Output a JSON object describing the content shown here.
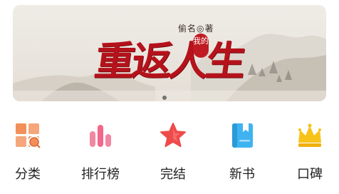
{
  "banner": {
    "author": "偷名◎著",
    "title_main": "重返人生",
    "title_seal": "我的",
    "active_slide": 1,
    "slide_count": 1
  },
  "nav": {
    "items": [
      {
        "label": "分类",
        "icon": "category-grid-icon"
      },
      {
        "label": "排行榜",
        "icon": "ranking-bars-icon"
      },
      {
        "label": "完结",
        "icon": "star-icon"
      },
      {
        "label": "新书",
        "icon": "new-book-icon"
      },
      {
        "label": "口碑",
        "icon": "crown-icon"
      }
    ]
  },
  "colors": {
    "category": "#f28f5a",
    "ranking": "#f2678a",
    "finished": "#ef4a4a",
    "newbook": "#3fb3f0",
    "crown": "#f7c31a",
    "title_red": "#b5121b"
  }
}
